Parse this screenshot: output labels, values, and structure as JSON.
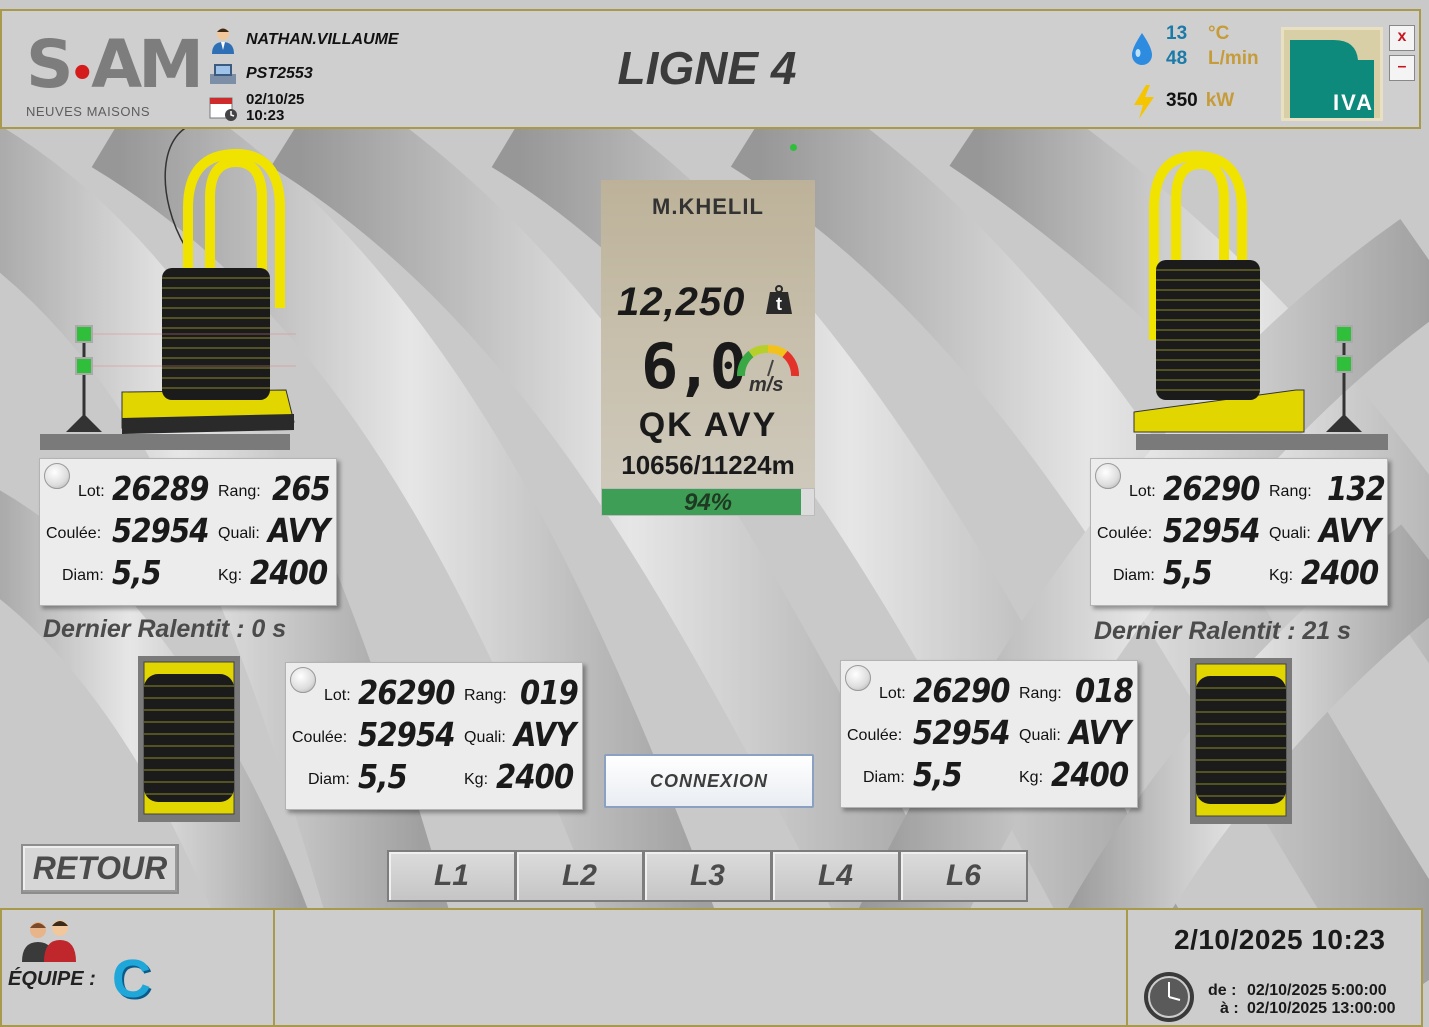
{
  "header": {
    "logo_text": "SAM",
    "logo_sub": "NEUVES MAISONS",
    "user": "NATHAN.VILLAUME",
    "station": "PST2553",
    "date_small": "02/10/25",
    "time_small": "10:23",
    "title": "LIGNE 4",
    "water_temp": "13",
    "water_temp_unit": "°C",
    "water_flow": "48",
    "water_flow_unit": "L/min",
    "power": "350",
    "power_unit": "kW",
    "logo_riva": "IVA",
    "close_label": "x",
    "minimize_label": "–"
  },
  "center": {
    "operator": "M.KHELIL",
    "tonnage": "12,250",
    "tonnage_unit": "t",
    "speed": "6,0",
    "speed_unit": "m/s",
    "quality": "QK  AVY",
    "length": "10656/11224m",
    "progress": 0.94,
    "progress_label": "94%"
  },
  "labels": {
    "lot": "Lot:",
    "rang": "Rang:",
    "coulee": "Coulée:",
    "quali": "Quali:",
    "diam": "Diam:",
    "kg": "Kg:"
  },
  "lots": {
    "top_left": {
      "lot": "26289",
      "rang": "265",
      "coulee": "52954",
      "quali": "AVY",
      "diam": "5,5",
      "kg": "2400"
    },
    "top_right": {
      "lot": "26290",
      "rang": "132",
      "coulee": "52954",
      "quali": "AVY",
      "diam": "5,5",
      "kg": "2400"
    },
    "mid_left": {
      "lot": "26290",
      "rang": "019",
      "coulee": "52954",
      "quali": "AVY",
      "diam": "5,5",
      "kg": "2400"
    },
    "mid_right": {
      "lot": "26290",
      "rang": "018",
      "coulee": "52954",
      "quali": "AVY",
      "diam": "5,5",
      "kg": "2400"
    }
  },
  "ralentit": {
    "left": "Dernier Ralentit :   0   s",
    "right": "Dernier Ralentit : 21  s"
  },
  "buttons": {
    "retour": "RETOUR",
    "connexion": "CONNEXION",
    "lines": [
      "L1",
      "L2",
      "L3",
      "L4",
      "L6"
    ]
  },
  "footer": {
    "team_label": "ÉQUIPE :",
    "team": "C",
    "datetime": "2/10/2025  10:23",
    "from_label": "de :",
    "from_value": "02/10/2025 5:00:00",
    "to_label": "à :",
    "to_value": "02/10/2025 13:00:00"
  },
  "colors": {
    "accent_gold": "#a89a4a",
    "progress_green": "#3e9e56",
    "status_led_green": "#2fbf3a",
    "coil_yellow": "#e2d600"
  }
}
